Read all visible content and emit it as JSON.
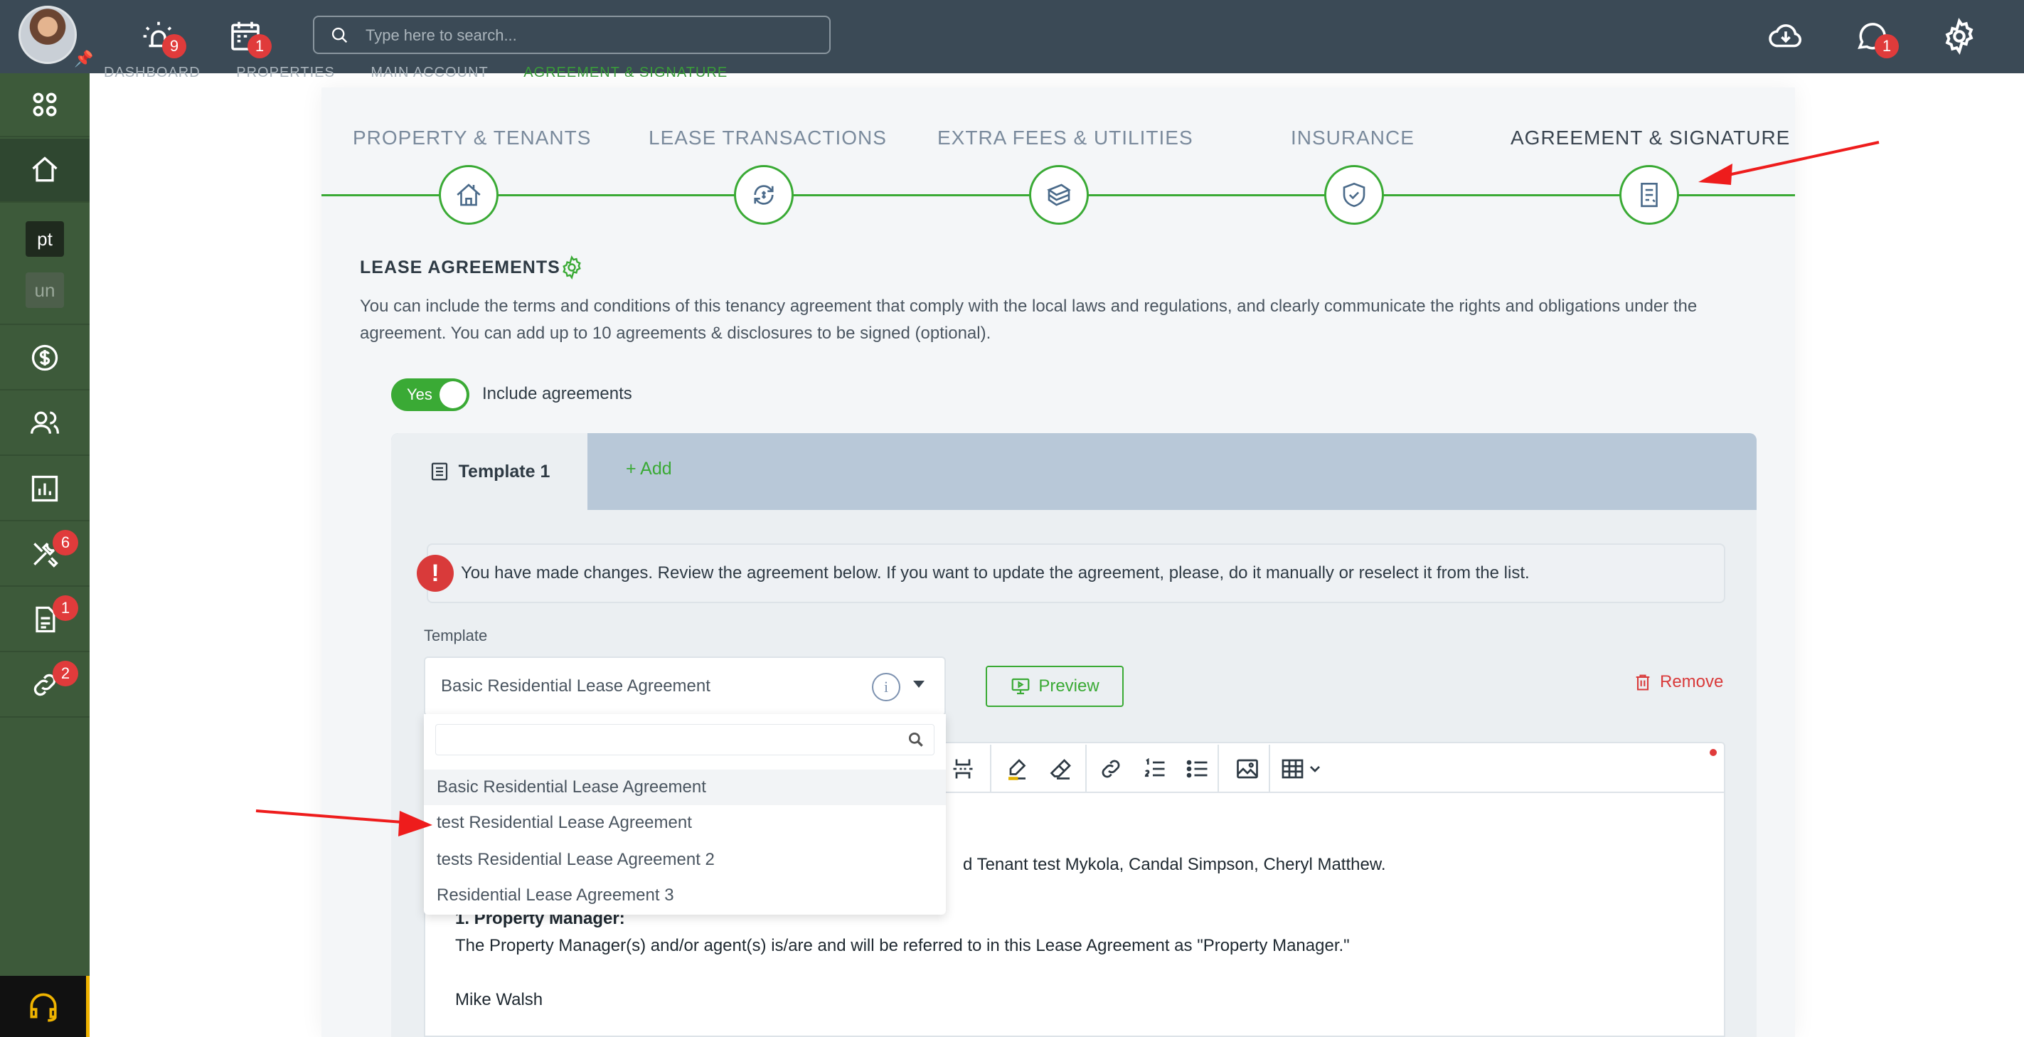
{
  "topbar": {
    "search_placeholder": "Type here to search...",
    "alarm_badge": "9",
    "calendar_badge": "1",
    "chat_badge": "1"
  },
  "sidebar": {
    "chip_pt": "pt",
    "chip_un": "un",
    "maintenance_badge": "6",
    "documents_badge": "1",
    "links_badge": "2"
  },
  "breadcrumb": [
    "DASHBOARD",
    "PROPERTIES",
    "MAIN ACCOUNT",
    "AGREEMENT & SIGNATURE"
  ],
  "steps": [
    {
      "label": "PROPERTY & TENANTS",
      "icon": "house-icon"
    },
    {
      "label": "LEASE TRANSACTIONS",
      "icon": "exchange-money-icon"
    },
    {
      "label": "EXTRA FEES & UTILITIES",
      "icon": "money-stack-icon"
    },
    {
      "label": "INSURANCE",
      "icon": "shield-check-icon"
    },
    {
      "label": "AGREEMENT & SIGNATURE",
      "icon": "document-icon"
    }
  ],
  "lease": {
    "title": "LEASE AGREEMENTS",
    "description": "You can include the terms and conditions of this tenancy agreement that comply with the local laws and regulations, and clearly communicate the rights and obligations under the agreement. You can add up to 10 agreements & disclosures to be signed (optional).",
    "toggle_label": "Yes",
    "include_label": "Include agreements"
  },
  "tabs": {
    "template1": "Template 1",
    "add": "Add"
  },
  "alert_text": "You have made changes. Review the agreement below. If you want to update the agreement, please, do it manually or reselect it from the list.",
  "template": {
    "label": "Template",
    "selected": "Basic Residential Lease Agreement",
    "preview": "Preview",
    "remove": "Remove"
  },
  "dropdown_options": [
    "Basic Residential Lease Agreement",
    "test Residential Lease Agreement",
    "tests Residential Lease Agreement 2",
    "Residential Lease Agreement 3"
  ],
  "editor": {
    "line_tenant": "d Tenant test Mykola, Candal Simpson, Cheryl Matthew.",
    "heading_pm": "1. Property Manager:",
    "line_pm": "The Property Manager(s) and/or agent(s) is/are and will be referred to in this Lease Agreement as \"Property Manager.\"",
    "line_name": "Mike Walsh"
  },
  "colors": {
    "accent": "#3aaa35",
    "topbar": "#3b4a56",
    "sidebar": "#3d5a3a",
    "danger": "#d93a3a"
  }
}
